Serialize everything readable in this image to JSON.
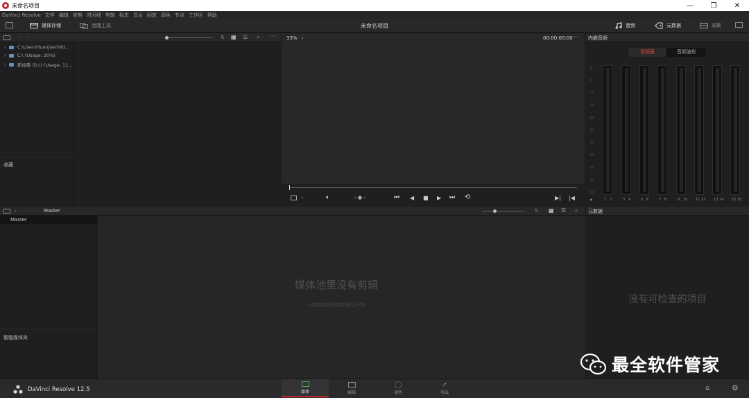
{
  "window": {
    "title": "未命名项目",
    "min": "—",
    "max": "❐",
    "close": "✕"
  },
  "menu": [
    "DaVinci Resolve",
    "文件",
    "编辑",
    "修剪",
    "时间线",
    "剪辑",
    "标志",
    "显示",
    "回放",
    "调色",
    "节点",
    "工作区",
    "帮助"
  ],
  "toolbar": {
    "media_storage": "媒体存储",
    "clone_tool": "克隆工具",
    "project_title": "未命名项目",
    "audio": "音频",
    "metadata": "元数据",
    "capture": "采集"
  },
  "media_storage": {
    "drives": [
      "C:\\Users\\Yuanjian\\Vid...",
      "C:\\ (Usage: 20%)",
      "新加卷 (D:\\) (Usage: 11..."
    ],
    "favorites": "收藏"
  },
  "viewer": {
    "zoom": "33%",
    "timecode": "00:00:00:00",
    "more": "···"
  },
  "audio_panel": {
    "header": "内嵌音频",
    "tab_meters": "音频表",
    "tab_waveform": "音频波形",
    "scale": [
      "0",
      "5",
      "10",
      "15",
      "20",
      "25",
      "30",
      "35",
      "40",
      "45",
      "50"
    ],
    "channels": [
      "1",
      "2",
      "3",
      "4",
      "5",
      "6",
      "7",
      "8",
      "9",
      "10",
      "11",
      "12",
      "13",
      "14",
      "15",
      "16"
    ]
  },
  "media_pool": {
    "header": "Master",
    "bin_master": "Master",
    "smart_bins": "智能媒体夹",
    "empty_title": "媒体池里没有剪辑",
    "empty_hint": "从媒体存储添加剪辑以开始"
  },
  "metadata_panel": {
    "header": "元数据",
    "empty": "没有可检查的项目"
  },
  "bottom": {
    "app_name": "DaVinci Resolve 12.5",
    "tabs": [
      "媒体",
      "编辑",
      "调色",
      "导出"
    ],
    "active_tab": "媒体"
  },
  "watermark": "最全软件管家",
  "colors": {
    "accent": "#c0292f",
    "meter_green": "#4caf50",
    "panel_bg": "#1f1f21"
  }
}
